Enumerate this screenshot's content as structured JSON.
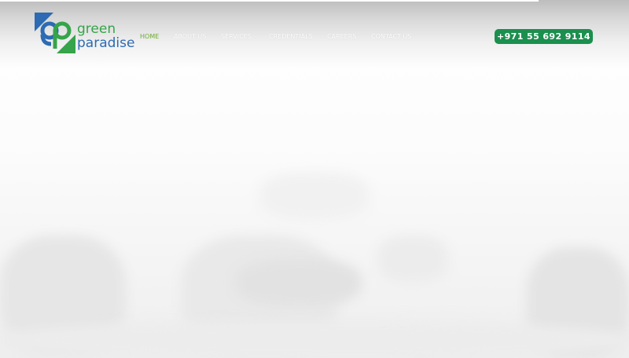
{
  "brand": {
    "name_line1": "green",
    "name_line2": "paradise",
    "accent_green": "#36a44a",
    "accent_blue": "#2d6bb3"
  },
  "nav": {
    "items": [
      {
        "label": "HOME",
        "active": true
      },
      {
        "label": "ABOUT US",
        "active": false
      },
      {
        "label": "SERVICES",
        "active": false
      },
      {
        "label": "CREDENTIALS",
        "active": false
      },
      {
        "label": "CAREERS",
        "active": false
      },
      {
        "label": "CONTACT US",
        "active": false
      }
    ],
    "active_color": "#79b83f"
  },
  "contact": {
    "phone": "+971 55 692 9114",
    "phone_bg": "#1b8f4e"
  }
}
